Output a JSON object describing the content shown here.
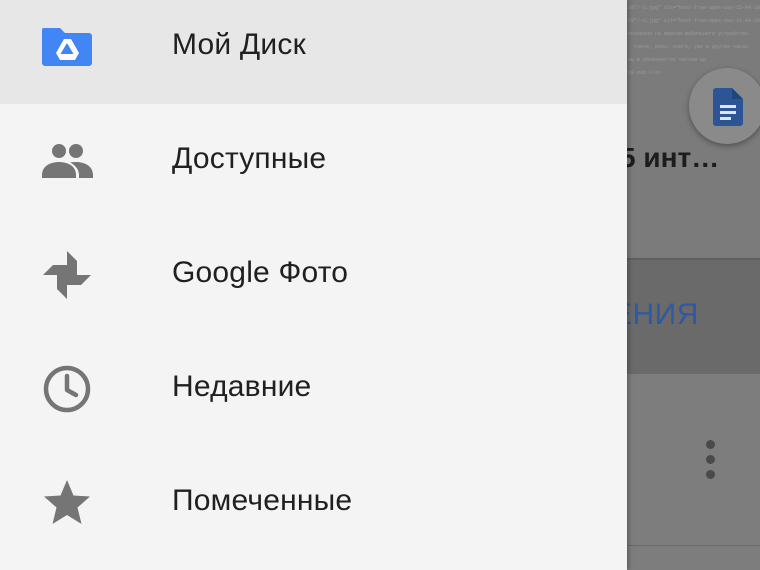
{
  "background": {
    "doc_title_fragment": "5 инт…",
    "band_label_fragment": "ЕНИЯ",
    "code_lines": [
      "20\"/-5.jpg\" alt=\"best-free-apps-day-15-04-20\"/>",
      "",
      "20\"/-6.jpg\" alt=\"best-free-apps-day-15-04-20\"/>",
      "",
      "основано на версии мобильного устройства.",
      "- гиене, ролл, книги, уже в других часах",
      "",
      "ны в облачностях числом ца",
      "",
      "20 pub.</a>"
    ],
    "fab_icon": "document-icon",
    "more_icon": "more-vert-icon"
  },
  "drawer": {
    "items": [
      {
        "label": "Мой Диск",
        "icon": "my-drive-icon",
        "active": true
      },
      {
        "label": "Доступные",
        "icon": "shared-people-icon",
        "active": false
      },
      {
        "label": "Google Фото",
        "icon": "google-photos-icon",
        "active": false
      },
      {
        "label": "Недавние",
        "icon": "clock-icon",
        "active": false
      },
      {
        "label": "Помеченные",
        "icon": "star-icon",
        "active": false
      }
    ]
  },
  "colors": {
    "drive_blue": "#4285f4",
    "icon_gray": "#757575",
    "text": "#202020",
    "drawer_bg": "#f4f4f4",
    "active_bg": "#e7e7e7",
    "accent_text": "#2f58a5"
  }
}
